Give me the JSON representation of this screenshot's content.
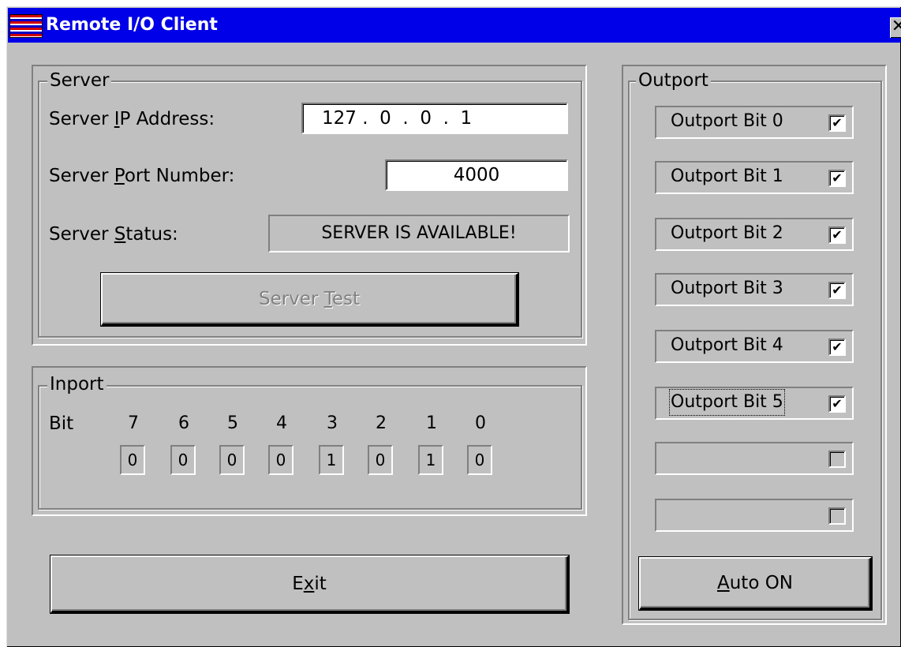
{
  "window": {
    "title": "Remote I/O Client",
    "close_glyph": "✕"
  },
  "server": {
    "legend": "Server",
    "ip_label": "Server IP Address:",
    "ip_value": "127 .  0  .  0  .  1",
    "port_label": "Server Port Number:",
    "port_value": "4000",
    "status_label": "Server Status:",
    "status_value": "SERVER IS AVAILABLE!",
    "test_button": "Server Test"
  },
  "inport": {
    "legend": "Inport",
    "bit_label": "Bit",
    "bit_numbers": [
      "7",
      "6",
      "5",
      "4",
      "3",
      "2",
      "1",
      "0"
    ],
    "bit_values": [
      "0",
      "0",
      "0",
      "0",
      "1",
      "0",
      "1",
      "0"
    ]
  },
  "exit_button": "Exit",
  "outport": {
    "legend": "Outport",
    "items": [
      {
        "label": "Outport Bit 0",
        "checked": true
      },
      {
        "label": "Outport Bit 1",
        "checked": true
      },
      {
        "label": "Outport Bit 2",
        "checked": true
      },
      {
        "label": "Outport Bit 3",
        "checked": true
      },
      {
        "label": "Outport Bit 4",
        "checked": true
      },
      {
        "label": "Outport Bit 5",
        "checked": true
      },
      {
        "label": "",
        "checked": false
      },
      {
        "label": "",
        "checked": false
      }
    ],
    "auto_button": "Auto ON",
    "check_glyph": "✔"
  }
}
